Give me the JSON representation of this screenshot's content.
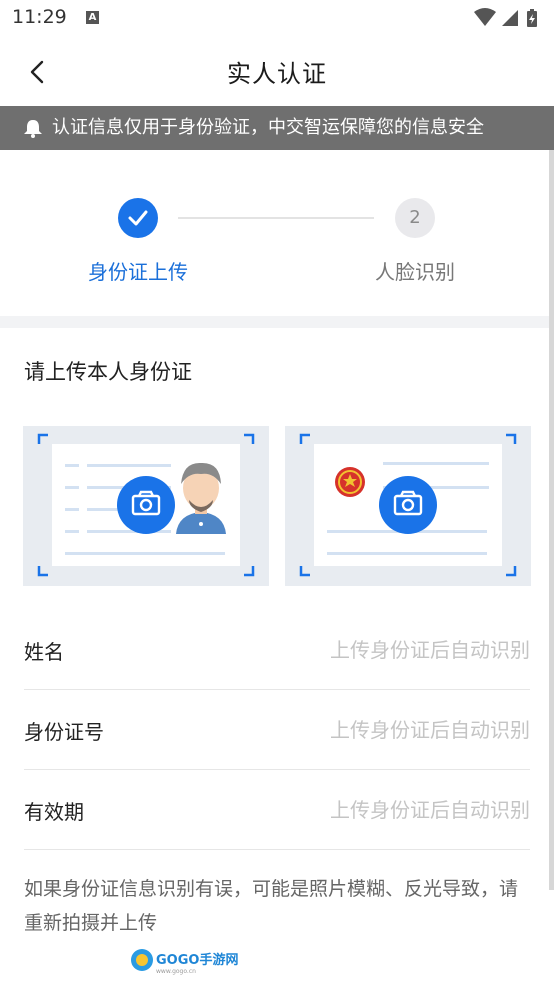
{
  "status_bar": {
    "time": "11:29",
    "notification_letter": "A",
    "icons": [
      "wifi-icon",
      "signal-icon",
      "battery-icon"
    ]
  },
  "nav": {
    "title": "实人认证",
    "back_icon": "chevron-left-icon"
  },
  "notice": {
    "icon": "bell-icon",
    "text": "认证信息仅用于身份验证，中交智运保障您的信息安全"
  },
  "steps": [
    {
      "label": "身份证上传",
      "state": "done",
      "icon": "check-icon"
    },
    {
      "label": "人脸识别",
      "number": "2",
      "state": "pending"
    }
  ],
  "upload": {
    "title": "请上传本人身份证",
    "cards": [
      {
        "side": "portrait",
        "icon": "camera-icon"
      },
      {
        "side": "emblem",
        "icon": "camera-icon"
      }
    ]
  },
  "form": {
    "fields": [
      {
        "label": "姓名",
        "value": "",
        "placeholder": "上传身份证后自动识别"
      },
      {
        "label": "身份证号",
        "value": "",
        "placeholder": "上传身份证后自动识别"
      },
      {
        "label": "有效期",
        "value": "",
        "placeholder": "上传身份证后自动识别"
      }
    ]
  },
  "hint": "如果身份证信息识别有误，可能是照片模糊、反光导致，请重新拍摄并上传",
  "watermark": {
    "brand": "GOGO手游网",
    "url": "www.gogo.cn"
  },
  "colors": {
    "accent": "#1a73e8",
    "notice_bg": "#6f6f6f",
    "placeholder": "#c4c4c4",
    "card_bg": "#e8ecf1"
  }
}
